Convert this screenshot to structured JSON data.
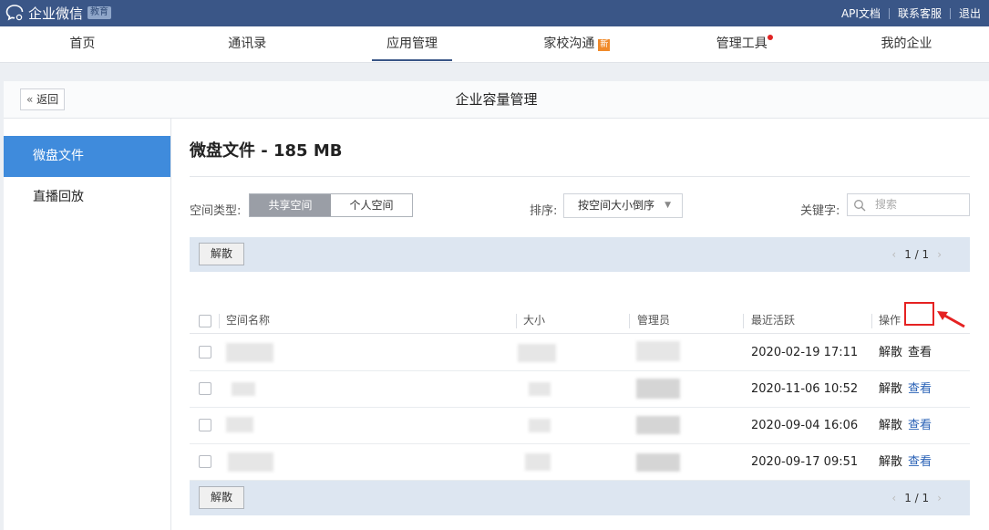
{
  "topbar": {
    "logo_text": "企业微信",
    "edu_badge": "教育",
    "links": [
      "API文档",
      "联系客服",
      "退出"
    ]
  },
  "nav": {
    "items": [
      {
        "label": "首页"
      },
      {
        "label": "通讯录"
      },
      {
        "label": "应用管理",
        "active": true
      },
      {
        "label": "家校沟通",
        "badge": "新"
      },
      {
        "label": "管理工具",
        "dot": true
      },
      {
        "label": "我的企业"
      }
    ]
  },
  "panel": {
    "back_label": "返回",
    "title": "企业容量管理"
  },
  "sidebar": {
    "items": [
      {
        "label": "微盘文件",
        "active": true
      },
      {
        "label": "直播回放"
      }
    ]
  },
  "content": {
    "title": "微盘文件 - 185 MB",
    "space_type_label": "空间类型:",
    "space_types": [
      "共享空间",
      "个人空间"
    ],
    "sort_label": "排序:",
    "sort_value": "按空间大小倒序",
    "keyword_label": "关键字:",
    "search_placeholder": "搜索",
    "dissolve_button": "解散",
    "pager": "1 / 1"
  },
  "table": {
    "columns": [
      "空间名称",
      "大小",
      "管理员",
      "最近活跃",
      "操作"
    ],
    "rows": [
      {
        "last_active": "2020-02-19 17:11",
        "action_dissolve": "解散",
        "action_view": "查看"
      },
      {
        "last_active": "2020-11-06 10:52",
        "action_dissolve": "解散",
        "action_view": "查看"
      },
      {
        "last_active": "2020-09-04 16:06",
        "action_dissolve": "解散",
        "action_view": "查看"
      },
      {
        "last_active": "2020-09-17 09:51",
        "action_dissolve": "解散",
        "action_view": "查看"
      }
    ]
  },
  "colors": {
    "topbar": "#3a5687",
    "sidebar_active": "#3f8bdc",
    "toolbar_bg": "#dde6f1",
    "highlight": "#e52222"
  }
}
